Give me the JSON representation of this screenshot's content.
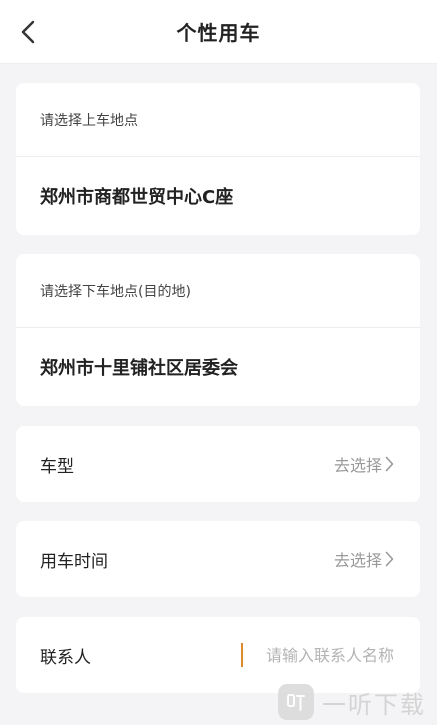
{
  "header": {
    "title": "个性用车",
    "back_icon": "chevron-left-icon"
  },
  "pickup": {
    "hint": "请选择上车地点",
    "value": "郑州市商都世贸中心C座"
  },
  "dropoff": {
    "hint": "请选择下车地点(目的地)",
    "value": "郑州市十里铺社区居委会"
  },
  "vehicle_type": {
    "label": "车型",
    "action": "去选择"
  },
  "use_time": {
    "label": "用车时间",
    "action": "去选择"
  },
  "contact": {
    "label": "联系人",
    "placeholder": "请输入联系人名称",
    "value": ""
  },
  "watermark": {
    "text": "一听下载"
  },
  "colors": {
    "background": "#f4f4f6",
    "card": "#ffffff",
    "caret": "#e08a2e",
    "muted_text": "#9a9a9a"
  }
}
